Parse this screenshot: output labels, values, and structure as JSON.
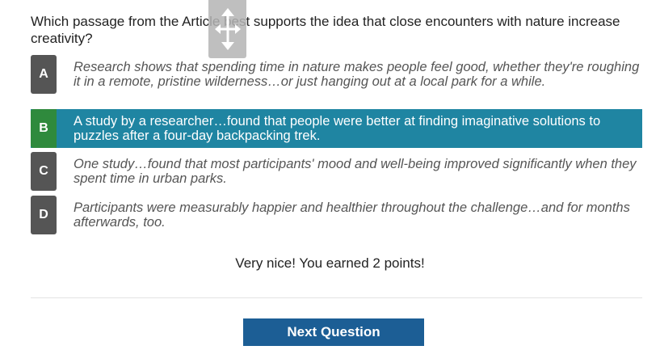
{
  "question": {
    "text": "Which passage from the Article best supports the idea that close encounters with nature increase creativity?"
  },
  "choices": [
    {
      "letter": "A",
      "text": "Research shows that spending time in nature makes people feel good, whether they're roughing it in a remote, pristine wilderness…or just hanging out at a local park for a while.",
      "selected": false
    },
    {
      "letter": "B",
      "text": "A study by a researcher…found that people were better at finding imaginative solutions to puzzles after a four-day backpacking trek.",
      "selected": true
    },
    {
      "letter": "C",
      "text": "One study…found that most participants' mood and well-being improved significantly when they spent time in urban parks.",
      "selected": false
    },
    {
      "letter": "D",
      "text": "Participants were measurably happier and healthier throughout the challenge…and for months afterwards, too.",
      "selected": false
    }
  ],
  "feedback": {
    "text": "Very nice! You earned 2 points!"
  },
  "next_button": {
    "label": "Next Question"
  },
  "colors": {
    "selected_bg": "#1f85a2",
    "correct_badge": "#2f8a3d",
    "badge": "#555555",
    "button": "#1c5e95"
  },
  "icons": {
    "move_handle": "move-arrows-icon"
  }
}
